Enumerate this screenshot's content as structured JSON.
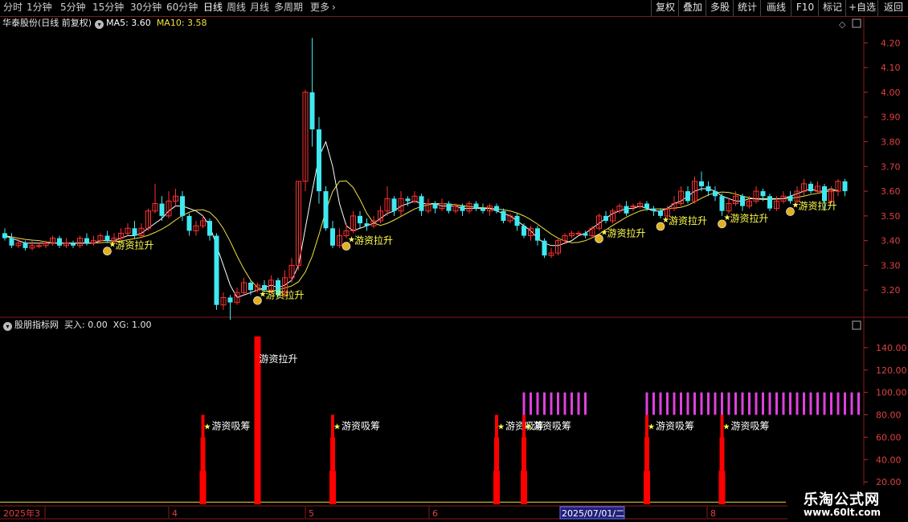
{
  "toolbar": {
    "periods": [
      "分时",
      "1分钟",
      "5分钟",
      "15分钟",
      "30分钟",
      "60分钟",
      "日线",
      "周线",
      "月线",
      "多周期",
      "更多"
    ],
    "active_period": "日线",
    "more_arrow": "chevron-right-icon",
    "right_buttons": [
      "复权",
      "叠加",
      "多股",
      "统计",
      "画线",
      "F10",
      "标记",
      "+自选",
      "返回"
    ]
  },
  "main_info": {
    "title": "华泰股份(日线 前复权)",
    "ma5": "MA5: 3.60",
    "ma10": "MA10: 3.58"
  },
  "sub_info": {
    "title": "股朋指标网",
    "buy": "买入: 0.00",
    "xg": "XG: 1.00"
  },
  "price_axis": [
    "4.20",
    "4.10",
    "4.00",
    "3.90",
    "3.80",
    "3.70",
    "3.60",
    "3.50",
    "3.40",
    "3.30",
    "3.20"
  ],
  "ind_axis": [
    "140.00",
    "120.00",
    "100.00",
    "80.00",
    "60.00",
    "40.00",
    "20.00"
  ],
  "date_axis": {
    "labels": [
      "2025年3",
      "4",
      "5",
      "6",
      "8"
    ],
    "cursor_label": "2025/07/01/二"
  },
  "signals": {
    "rise_label": "游资拉升",
    "absorb_label": "游资吸筹"
  },
  "chart_data": {
    "type": "candlestick",
    "price_range": [
      3.1,
      4.25
    ],
    "indicator_range": [
      0,
      155
    ],
    "colors": {
      "up": "#ff3030",
      "down": "#40e8f0",
      "ma5": "#ffffff",
      "ma10": "#f0e040",
      "bar": "#ff0000",
      "magenta": "#e040e0",
      "label": "#ffff50"
    },
    "candles": [
      [
        3.43,
        3.41,
        3.45,
        3.4
      ],
      [
        3.41,
        3.38,
        3.43,
        3.37
      ],
      [
        3.38,
        3.39,
        3.41,
        3.37
      ],
      [
        3.39,
        3.37,
        3.4,
        3.36
      ],
      [
        3.37,
        3.38,
        3.4,
        3.36
      ],
      [
        3.38,
        3.38,
        3.39,
        3.37
      ],
      [
        3.38,
        3.39,
        3.4,
        3.37
      ],
      [
        3.39,
        3.41,
        3.42,
        3.38
      ],
      [
        3.41,
        3.38,
        3.42,
        3.37
      ],
      [
        3.38,
        3.39,
        3.41,
        3.37
      ],
      [
        3.39,
        3.38,
        3.4,
        3.37
      ],
      [
        3.38,
        3.41,
        3.42,
        3.37
      ],
      [
        3.41,
        3.39,
        3.43,
        3.38
      ],
      [
        3.39,
        3.4,
        3.42,
        3.38
      ],
      [
        3.4,
        3.42,
        3.43,
        3.39
      ],
      [
        3.42,
        3.4,
        3.44,
        3.39
      ],
      [
        3.4,
        3.41,
        3.43,
        3.39
      ],
      [
        3.41,
        3.43,
        3.45,
        3.4
      ],
      [
        3.43,
        3.45,
        3.47,
        3.42
      ],
      [
        3.45,
        3.42,
        3.48,
        3.41
      ],
      [
        3.42,
        3.45,
        3.47,
        3.41
      ],
      [
        3.45,
        3.52,
        3.53,
        3.44
      ],
      [
        3.52,
        3.55,
        3.63,
        3.51
      ],
      [
        3.55,
        3.5,
        3.58,
        3.48
      ],
      [
        3.5,
        3.56,
        3.6,
        3.49
      ],
      [
        3.56,
        3.58,
        3.61,
        3.54
      ],
      [
        3.58,
        3.5,
        3.6,
        3.48
      ],
      [
        3.5,
        3.44,
        3.51,
        3.42
      ],
      [
        3.44,
        3.46,
        3.48,
        3.42
      ],
      [
        3.46,
        3.48,
        3.5,
        3.45
      ],
      [
        3.48,
        3.42,
        3.49,
        3.4
      ],
      [
        3.42,
        3.14,
        3.43,
        3.12
      ],
      [
        3.14,
        3.17,
        3.19,
        3.12
      ],
      [
        3.17,
        3.15,
        3.18,
        3.08
      ],
      [
        3.15,
        3.19,
        3.21,
        3.14
      ],
      [
        3.19,
        3.23,
        3.25,
        3.18
      ],
      [
        3.23,
        3.2,
        3.24,
        3.18
      ],
      [
        3.2,
        3.22,
        3.23,
        3.19
      ],
      [
        3.22,
        3.2,
        3.24,
        3.19
      ],
      [
        3.2,
        3.24,
        3.26,
        3.19
      ],
      [
        3.24,
        3.18,
        3.25,
        3.17
      ],
      [
        3.18,
        3.25,
        3.28,
        3.17
      ],
      [
        3.25,
        3.3,
        3.33,
        3.23
      ],
      [
        3.3,
        3.64,
        3.64,
        3.28
      ],
      [
        3.64,
        4.0,
        4.01,
        3.6
      ],
      [
        4.0,
        3.85,
        4.22,
        3.78
      ],
      [
        3.85,
        3.6,
        3.9,
        3.55
      ],
      [
        3.6,
        3.45,
        3.62,
        3.44
      ],
      [
        3.45,
        3.38,
        3.48,
        3.37
      ],
      [
        3.38,
        3.42,
        3.45,
        3.37
      ],
      [
        3.42,
        3.44,
        3.47,
        3.41
      ],
      [
        3.44,
        3.5,
        3.52,
        3.43
      ],
      [
        3.5,
        3.47,
        3.52,
        3.45
      ],
      [
        3.47,
        3.46,
        3.49,
        3.44
      ],
      [
        3.46,
        3.48,
        3.5,
        3.45
      ],
      [
        3.48,
        3.52,
        3.54,
        3.47
      ],
      [
        3.52,
        3.57,
        3.62,
        3.5
      ],
      [
        3.57,
        3.52,
        3.58,
        3.5
      ],
      [
        3.52,
        3.57,
        3.6,
        3.5
      ],
      [
        3.57,
        3.56,
        3.58,
        3.54
      ],
      [
        3.56,
        3.58,
        3.6,
        3.55
      ],
      [
        3.58,
        3.52,
        3.59,
        3.5
      ],
      [
        3.52,
        3.55,
        3.57,
        3.51
      ],
      [
        3.55,
        3.53,
        3.56,
        3.51
      ],
      [
        3.53,
        3.55,
        3.57,
        3.52
      ],
      [
        3.55,
        3.52,
        3.56,
        3.51
      ],
      [
        3.52,
        3.54,
        3.55,
        3.51
      ],
      [
        3.54,
        3.52,
        3.55,
        3.5
      ],
      [
        3.52,
        3.55,
        3.56,
        3.51
      ],
      [
        3.55,
        3.53,
        3.56,
        3.52
      ],
      [
        3.53,
        3.52,
        3.55,
        3.51
      ],
      [
        3.52,
        3.54,
        3.55,
        3.5
      ],
      [
        3.54,
        3.52,
        3.55,
        3.51
      ],
      [
        3.52,
        3.48,
        3.53,
        3.47
      ],
      [
        3.48,
        3.5,
        3.51,
        3.47
      ],
      [
        3.5,
        3.46,
        3.51,
        3.44
      ],
      [
        3.46,
        3.42,
        3.47,
        3.41
      ],
      [
        3.42,
        3.45,
        3.46,
        3.4
      ],
      [
        3.45,
        3.4,
        3.46,
        3.38
      ],
      [
        3.4,
        3.34,
        3.41,
        3.33
      ],
      [
        3.34,
        3.35,
        3.37,
        3.33
      ],
      [
        3.35,
        3.4,
        3.41,
        3.34
      ],
      [
        3.4,
        3.42,
        3.43,
        3.39
      ],
      [
        3.42,
        3.43,
        3.44,
        3.41
      ],
      [
        3.43,
        3.43,
        3.44,
        3.42
      ],
      [
        3.43,
        3.42,
        3.44,
        3.41
      ],
      [
        3.42,
        3.45,
        3.46,
        3.41
      ],
      [
        3.45,
        3.5,
        3.51,
        3.44
      ],
      [
        3.5,
        3.48,
        3.52,
        3.47
      ],
      [
        3.48,
        3.52,
        3.53,
        3.47
      ],
      [
        3.52,
        3.54,
        3.55,
        3.51
      ],
      [
        3.54,
        3.51,
        3.56,
        3.5
      ],
      [
        3.54,
        3.54,
        3.55,
        3.52
      ],
      [
        3.54,
        3.55,
        3.56,
        3.53
      ],
      [
        3.55,
        3.53,
        3.56,
        3.52
      ],
      [
        3.53,
        3.52,
        3.54,
        3.5
      ],
      [
        3.52,
        3.5,
        3.53,
        3.49
      ],
      [
        3.5,
        3.53,
        3.54,
        3.49
      ],
      [
        3.53,
        3.55,
        3.58,
        3.52
      ],
      [
        3.55,
        3.6,
        3.62,
        3.54
      ],
      [
        3.6,
        3.56,
        3.62,
        3.55
      ],
      [
        3.56,
        3.64,
        3.66,
        3.55
      ],
      [
        3.64,
        3.62,
        3.68,
        3.6
      ],
      [
        3.62,
        3.6,
        3.64,
        3.58
      ],
      [
        3.6,
        3.58,
        3.62,
        3.56
      ],
      [
        3.58,
        3.52,
        3.59,
        3.5
      ],
      [
        3.52,
        3.55,
        3.57,
        3.51
      ],
      [
        3.55,
        3.58,
        3.6,
        3.54
      ],
      [
        3.58,
        3.54,
        3.59,
        3.52
      ],
      [
        3.54,
        3.56,
        3.58,
        3.53
      ],
      [
        3.56,
        3.6,
        3.62,
        3.55
      ],
      [
        3.6,
        3.58,
        3.61,
        3.56
      ],
      [
        3.58,
        3.53,
        3.59,
        3.52
      ],
      [
        3.53,
        3.56,
        3.58,
        3.52
      ],
      [
        3.56,
        3.58,
        3.6,
        3.55
      ],
      [
        3.58,
        3.56,
        3.6,
        3.55
      ],
      [
        3.56,
        3.6,
        3.62,
        3.55
      ],
      [
        3.6,
        3.63,
        3.65,
        3.58
      ],
      [
        3.63,
        3.6,
        3.64,
        3.59
      ],
      [
        3.6,
        3.62,
        3.64,
        3.59
      ],
      [
        3.62,
        3.56,
        3.63,
        3.52
      ],
      [
        3.56,
        3.6,
        3.62,
        3.55
      ],
      [
        3.6,
        3.64,
        3.65,
        3.58
      ],
      [
        3.64,
        3.6,
        3.65,
        3.58
      ]
    ],
    "ma5": [
      3.42,
      3.41,
      3.4,
      3.39,
      3.39,
      3.39,
      3.39,
      3.39,
      3.39,
      3.39,
      3.39,
      3.39,
      3.39,
      3.39,
      3.4,
      3.4,
      3.4,
      3.41,
      3.42,
      3.42,
      3.43,
      3.45,
      3.47,
      3.49,
      3.52,
      3.54,
      3.54,
      3.53,
      3.52,
      3.5,
      3.46,
      3.38,
      3.3,
      3.22,
      3.17,
      3.18,
      3.19,
      3.2,
      3.21,
      3.22,
      3.21,
      3.22,
      3.24,
      3.3,
      3.45,
      3.6,
      3.74,
      3.8,
      3.7,
      3.55,
      3.46,
      3.44,
      3.45,
      3.46,
      3.47,
      3.49,
      3.51,
      3.52,
      3.54,
      3.55,
      3.56,
      3.55,
      3.55,
      3.55,
      3.54,
      3.54,
      3.54,
      3.53,
      3.53,
      3.53,
      3.53,
      3.53,
      3.52,
      3.51,
      3.5,
      3.48,
      3.46,
      3.44,
      3.41,
      3.39,
      3.38,
      3.38,
      3.39,
      3.4,
      3.42,
      3.43,
      3.45,
      3.47,
      3.49,
      3.51,
      3.52,
      3.53,
      3.53,
      3.54,
      3.53,
      3.52,
      3.52,
      3.53,
      3.55,
      3.56,
      3.58,
      3.6,
      3.61,
      3.61,
      3.6,
      3.58,
      3.57,
      3.56,
      3.56,
      3.57,
      3.57,
      3.57,
      3.57,
      3.57,
      3.57,
      3.58,
      3.59,
      3.6,
      3.61,
      3.6,
      3.6,
      3.61,
      3.6
    ]
  }
}
